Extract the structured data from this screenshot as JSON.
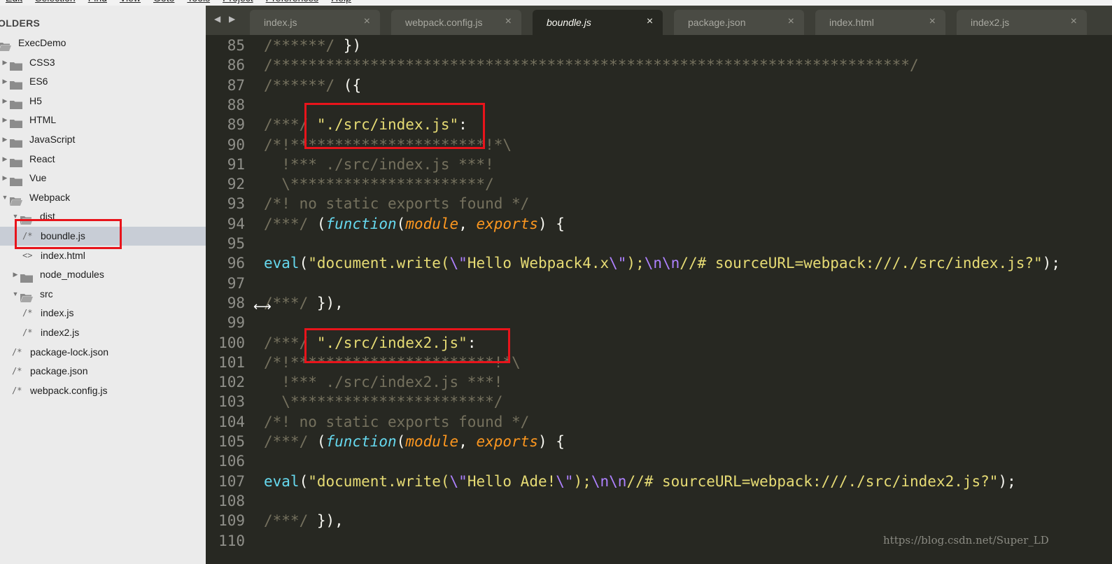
{
  "menu": [
    "Edit",
    "Selection",
    "Find",
    "View",
    "Goto",
    "Tools",
    "Project",
    "Preferences",
    "Help"
  ],
  "sidebar": {
    "header": "OLDERS",
    "items": [
      {
        "label": "ExecDemo",
        "type": "folder-open",
        "arrow": ""
      },
      {
        "label": "CSS3",
        "type": "folder",
        "arrow": "▶"
      },
      {
        "label": "ES6",
        "type": "folder",
        "arrow": "▶"
      },
      {
        "label": "H5",
        "type": "folder",
        "arrow": "▶"
      },
      {
        "label": "HTML",
        "type": "folder",
        "arrow": "▶"
      },
      {
        "label": "JavaScript",
        "type": "folder",
        "arrow": "▶"
      },
      {
        "label": "React",
        "type": "folder",
        "arrow": "▶"
      },
      {
        "label": "Vue",
        "type": "folder",
        "arrow": "▶"
      },
      {
        "label": "Webpack",
        "type": "folder-open",
        "arrow": "▼"
      },
      {
        "label": "dist",
        "type": "folder-open",
        "arrow": "▼"
      },
      {
        "label": "boundle.js",
        "type": "file",
        "icon": "/*"
      },
      {
        "label": "index.html",
        "type": "file",
        "icon": "<>"
      },
      {
        "label": "node_modules",
        "type": "folder",
        "arrow": "▶"
      },
      {
        "label": "src",
        "type": "folder-open",
        "arrow": "▼"
      },
      {
        "label": "index.js",
        "type": "file",
        "icon": "/*"
      },
      {
        "label": "index2.js",
        "type": "file",
        "icon": "/*"
      },
      {
        "label": "package-lock.json",
        "type": "file",
        "icon": "/*"
      },
      {
        "label": "package.json",
        "type": "file",
        "icon": "/*"
      },
      {
        "label": "webpack.config.js",
        "type": "file",
        "icon": "/*"
      }
    ]
  },
  "tabs": {
    "nav": "◀ ▶",
    "items": [
      {
        "label": "index.js",
        "close": "×"
      },
      {
        "label": "webpack.config.js",
        "close": "×"
      },
      {
        "label": "boundle.js",
        "close": "×"
      },
      {
        "label": "package.json",
        "close": "×"
      },
      {
        "label": "index.html",
        "close": "×"
      },
      {
        "label": "index2.js",
        "close": "×"
      }
    ]
  },
  "editor": {
    "lines": [
      {
        "n": "85",
        "html": "<span class=\"c\">/******/</span> })"
      },
      {
        "n": "86",
        "html": "<span class=\"c\">/************************************************************************/</span>"
      },
      {
        "n": "87",
        "html": "<span class=\"c\">/******/</span> ({"
      },
      {
        "n": "88",
        "html": ""
      },
      {
        "n": "89",
        "html": "<span class=\"c\">/***/</span> <span class=\"s\">\"./src/index.js\"</span>:"
      },
      {
        "n": "90",
        "html": "<span class=\"c\">/*!**********************!*\\</span>"
      },
      {
        "n": "91",
        "html": "<span class=\"c\">  !*** ./src/index.js ***!</span>"
      },
      {
        "n": "92",
        "html": "<span class=\"c\">  \\**********************/</span>"
      },
      {
        "n": "93",
        "html": "<span class=\"c\">/*! no static exports found */</span>"
      },
      {
        "n": "94",
        "html": "<span class=\"c\">/***/</span> (<span class=\"k\">function</span>(<span class=\"p\">module</span>, <span class=\"p\">exports</span>) {"
      },
      {
        "n": "95",
        "html": ""
      },
      {
        "n": "96",
        "html": "<span class=\"f\">eval</span>(<span class=\"s\">\"document.write(</span><span class=\"e\">\\\"</span><span class=\"s\">Hello Webpack4.x</span><span class=\"e\">\\\"</span><span class=\"s\">);</span><span class=\"e\">\\n\\n</span><span class=\"s\">//# sourceURL=webpack:///./src/index.js?\"</span>);"
      },
      {
        "n": "97",
        "html": ""
      },
      {
        "n": "98",
        "html": "<span class=\"c\">/***/</span> }),"
      },
      {
        "n": "99",
        "html": ""
      },
      {
        "n": "100",
        "html": "<span class=\"c\">/***/</span> <span class=\"s\">\"./src/index2.js\"</span>:"
      },
      {
        "n": "101",
        "html": "<span class=\"c\">/*!***********************!*\\</span>"
      },
      {
        "n": "102",
        "html": "<span class=\"c\">  !*** ./src/index2.js ***!</span>"
      },
      {
        "n": "103",
        "html": "<span class=\"c\">  \\***********************/</span>"
      },
      {
        "n": "104",
        "html": "<span class=\"c\">/*! no static exports found */</span>"
      },
      {
        "n": "105",
        "html": "<span class=\"c\">/***/</span> (<span class=\"k\">function</span>(<span class=\"p\">module</span>, <span class=\"p\">exports</span>) {"
      },
      {
        "n": "106",
        "html": ""
      },
      {
        "n": "107",
        "html": "<span class=\"f\">eval</span>(<span class=\"s\">\"document.write(</span><span class=\"e\">\\\"</span><span class=\"s\">Hello Ade!</span><span class=\"e\">\\\"</span><span class=\"s\">);</span><span class=\"e\">\\n\\n</span><span class=\"s\">//# sourceURL=webpack:///./src/index2.js?\"</span>);"
      },
      {
        "n": "108",
        "html": ""
      },
      {
        "n": "109",
        "html": "<span class=\"c\">/***/</span> }),"
      },
      {
        "n": "110",
        "html": ""
      }
    ]
  },
  "watermark": "https://blog.csdn.net/Super_LD",
  "colors": {
    "highlight": "#e8141b",
    "editor_bg": "#272822",
    "sidebar_bg": "#ebebeb"
  }
}
